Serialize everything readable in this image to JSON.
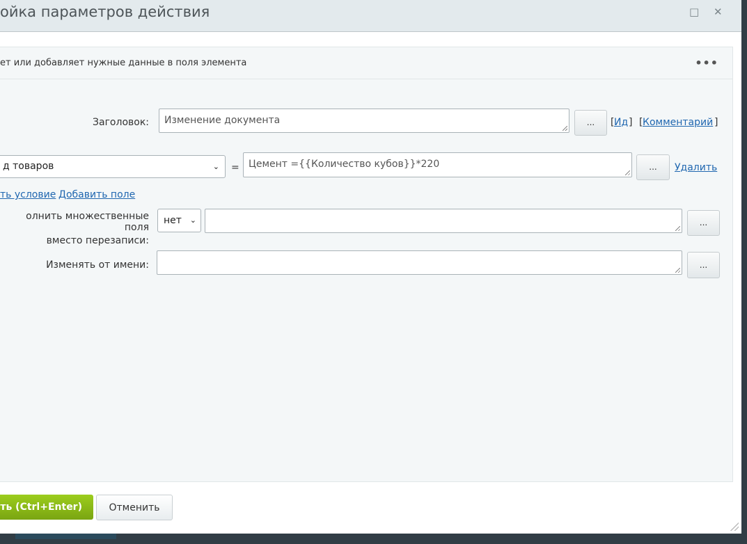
{
  "dialog": {
    "title": "ойка параметров действия",
    "maximize_icon": "□",
    "close_icon": "✕"
  },
  "panel": {
    "description": "ет или добавляет нужные данные в поля элемента",
    "menu": "•••"
  },
  "form": {
    "title_label": "Заголовок:",
    "title_value": "Изменение документа",
    "dots": "...",
    "id_open": "[",
    "id_link": "Ид",
    "id_close": "]",
    "comment_open": "[",
    "comment_link": "Комментарий",
    "comment_close": "]",
    "field_select": "д товаров",
    "equals": "=",
    "field_value": "Цемент ={{Количество кубов}}*220",
    "delete_link": "Удалить",
    "add_condition": "ть условие",
    "add_field": "Добавить поле",
    "multi_label_1": "олнить множественные поля",
    "multi_label_2": "вместо перезаписи:",
    "multi_select": "нет",
    "modified_by_label": "Изменять от имени:"
  },
  "footer": {
    "save": "ить (Ctrl+Enter)",
    "cancel": "Отменить"
  }
}
